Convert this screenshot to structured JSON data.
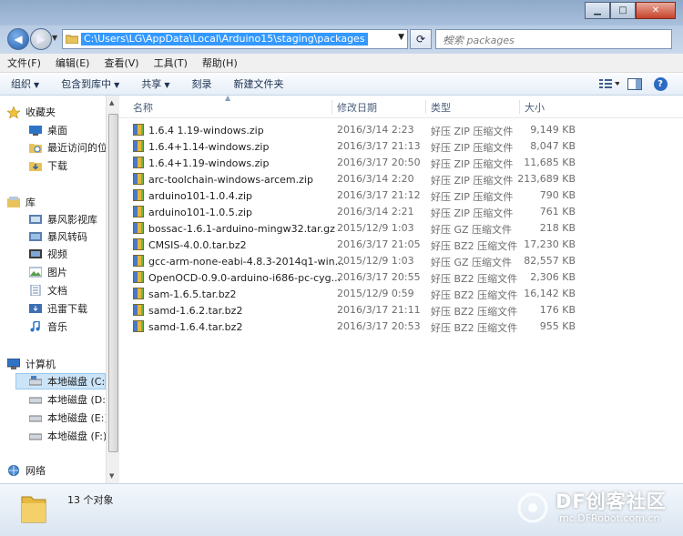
{
  "address": {
    "path": "C:\\Users\\LG\\AppData\\Local\\Arduino15\\staging\\packages",
    "search_placeholder": "搜索 packages"
  },
  "menu": [
    "文件(F)",
    "编辑(E)",
    "查看(V)",
    "工具(T)",
    "帮助(H)"
  ],
  "toolbar": {
    "organize": "组织",
    "include_library": "包含到库中",
    "share": "共享",
    "burn": "刻录",
    "new_folder": "新建文件夹"
  },
  "nav": {
    "favorites": {
      "label": "收藏夹",
      "items": [
        "桌面",
        "最近访问的位",
        "下载"
      ]
    },
    "libraries": {
      "label": "库",
      "items": [
        "暴风影视库",
        "暴风转码",
        "视频",
        "图片",
        "文档",
        "迅雷下载",
        "音乐"
      ]
    },
    "computer": {
      "label": "计算机",
      "items": [
        "本地磁盘 (C:)",
        "本地磁盘 (D:)",
        "本地磁盘 (E:)",
        "本地磁盘 (F:)"
      ]
    },
    "network": {
      "label": "网络"
    }
  },
  "columns": {
    "name": "名称",
    "date": "修改日期",
    "type": "类型",
    "size": "大小"
  },
  "files": [
    {
      "name": "1.6.4 1.19-windows.zip",
      "date": "2016/3/14 2:23",
      "type": "好压 ZIP 压缩文件",
      "size": "9,149 KB"
    },
    {
      "name": "1.6.4+1.14-windows.zip",
      "date": "2016/3/17 21:13",
      "type": "好压 ZIP 压缩文件",
      "size": "8,047 KB"
    },
    {
      "name": "1.6.4+1.19-windows.zip",
      "date": "2016/3/17 20:50",
      "type": "好压 ZIP 压缩文件",
      "size": "11,685 KB"
    },
    {
      "name": "arc-toolchain-windows-arcem.zip",
      "date": "2016/3/14 2:20",
      "type": "好压 ZIP 压缩文件",
      "size": "213,689 KB"
    },
    {
      "name": "arduino101-1.0.4.zip",
      "date": "2016/3/17 21:12",
      "type": "好压 ZIP 压缩文件",
      "size": "790 KB"
    },
    {
      "name": "arduino101-1.0.5.zip",
      "date": "2016/3/14 2:21",
      "type": "好压 ZIP 压缩文件",
      "size": "761 KB"
    },
    {
      "name": "bossac-1.6.1-arduino-mingw32.tar.gz",
      "date": "2015/12/9 1:03",
      "type": "好压 GZ 压缩文件",
      "size": "218 KB"
    },
    {
      "name": "CMSIS-4.0.0.tar.bz2",
      "date": "2016/3/17 21:05",
      "type": "好压 BZ2 压缩文件",
      "size": "17,230 KB"
    },
    {
      "name": "gcc-arm-none-eabi-4.8.3-2014q1-win...",
      "date": "2015/12/9 1:03",
      "type": "好压 GZ 压缩文件",
      "size": "82,557 KB"
    },
    {
      "name": "OpenOCD-0.9.0-arduino-i686-pc-cyg...",
      "date": "2016/3/17 20:55",
      "type": "好压 BZ2 压缩文件",
      "size": "2,306 KB"
    },
    {
      "name": "sam-1.6.5.tar.bz2",
      "date": "2015/12/9 0:59",
      "type": "好压 BZ2 压缩文件",
      "size": "16,142 KB"
    },
    {
      "name": "samd-1.6.2.tar.bz2",
      "date": "2016/3/17 21:11",
      "type": "好压 BZ2 压缩文件",
      "size": "176 KB"
    },
    {
      "name": "samd-1.6.4.tar.bz2",
      "date": "2016/3/17 20:53",
      "type": "好压 BZ2 压缩文件",
      "size": "955 KB"
    }
  ],
  "status": {
    "count": "13 个对象"
  },
  "watermark": {
    "title": "DF创客社区",
    "url": "mc.DFRobot.com.cn"
  }
}
